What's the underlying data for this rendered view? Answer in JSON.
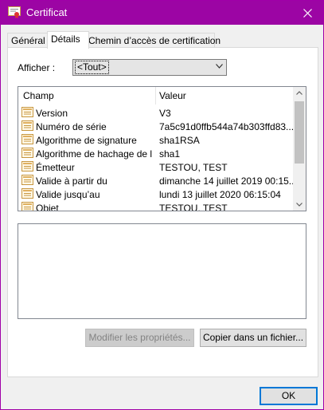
{
  "window": {
    "title": "Certificat"
  },
  "tabs": [
    {
      "label": "Général"
    },
    {
      "label": "Détails"
    },
    {
      "label": "Chemin d’accès de certification"
    }
  ],
  "filter": {
    "label": "Afficher :",
    "value": "<Tout>"
  },
  "table": {
    "columns": [
      "Champ",
      "Valeur"
    ],
    "rows": [
      {
        "field": "Version",
        "value": "V3"
      },
      {
        "field": "Numéro de série",
        "value": "7a5c91d0ffb544a74b303ffd83..."
      },
      {
        "field": "Algorithme de signature",
        "value": "sha1RSA"
      },
      {
        "field": "Algorithme de hachage de l...",
        "value": "sha1"
      },
      {
        "field": "Émetteur",
        "value": "TESTOU, TEST"
      },
      {
        "field": "Valide à partir du",
        "value": "dimanche 14 juillet 2019 00:15..."
      },
      {
        "field": "Valide jusqu’au",
        "value": "lundi 13 juillet 2020 06:15:04"
      },
      {
        "field": "Objet",
        "value": "TESTOU, TEST"
      }
    ]
  },
  "buttons": {
    "edit_properties": "Modifier les propriétés...",
    "copy_to_file": "Copier dans un fichier...",
    "ok": "OK"
  },
  "icons": {
    "window": "certificate-icon",
    "field": "certificate-field-icon"
  },
  "colors": {
    "titlebar": "#9c05a4",
    "ok_border": "#0078d7"
  }
}
